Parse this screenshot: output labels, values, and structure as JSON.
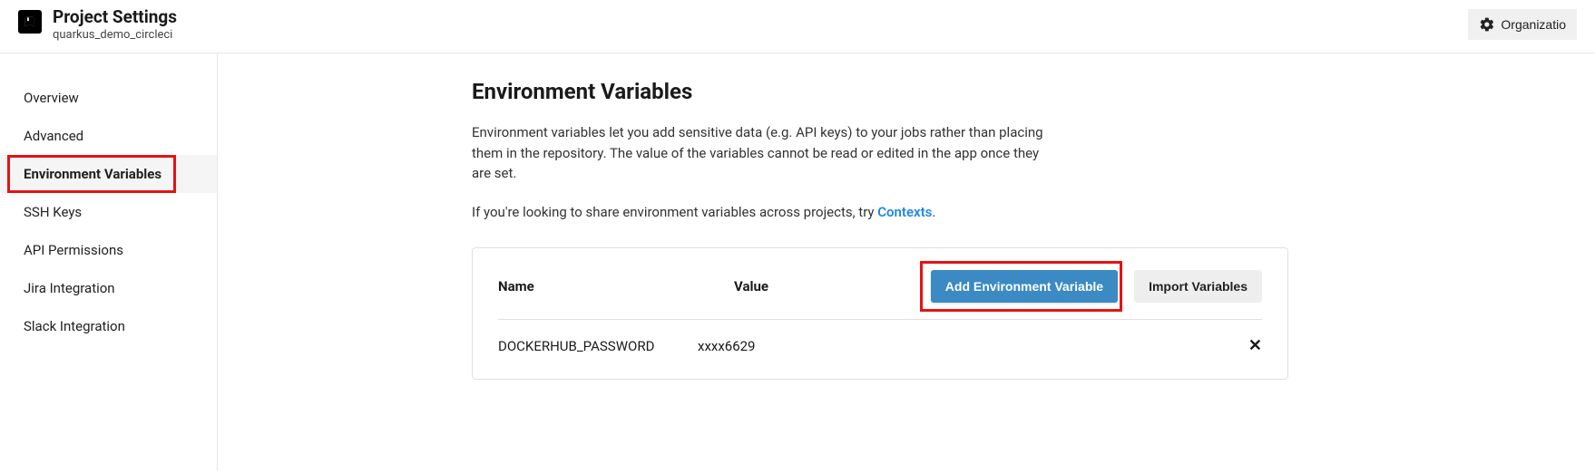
{
  "header": {
    "title": "Project Settings",
    "subtitle": "quarkus_demo_circleci",
    "org_button": "Organizatio"
  },
  "sidebar": {
    "items": [
      {
        "label": "Overview"
      },
      {
        "label": "Advanced"
      },
      {
        "label": "Environment Variables"
      },
      {
        "label": "SSH Keys"
      },
      {
        "label": "API Permissions"
      },
      {
        "label": "Jira Integration"
      },
      {
        "label": "Slack Integration"
      }
    ],
    "active_index": 2
  },
  "main": {
    "title": "Environment Variables",
    "description": "Environment variables let you add sensitive data (e.g. API keys) to your jobs rather than placing them in the repository. The value of the variables cannot be read or edited in the app once they are set.",
    "share_text_prefix": "If you're looking to share environment variables across projects, try ",
    "share_link_text": "Contexts",
    "share_text_suffix": ".",
    "table": {
      "columns": {
        "name": "Name",
        "value": "Value"
      },
      "actions": {
        "add": "Add Environment Variable",
        "import": "Import Variables"
      },
      "rows": [
        {
          "name": "DOCKERHUB_PASSWORD",
          "value": "xxxx6629"
        }
      ]
    }
  }
}
